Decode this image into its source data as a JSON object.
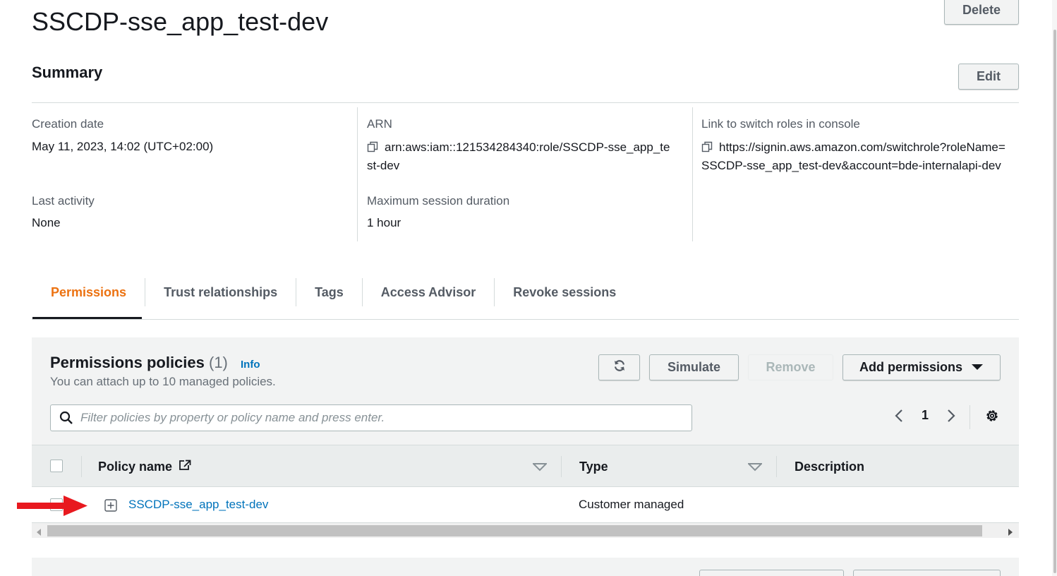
{
  "header": {
    "title": "SSCDP-sse_app_test-dev",
    "delete_label": "Delete"
  },
  "summary": {
    "title": "Summary",
    "edit_label": "Edit",
    "creation_date_label": "Creation date",
    "creation_date_value": "May 11, 2023, 14:02 (UTC+02:00)",
    "last_activity_label": "Last activity",
    "last_activity_value": "None",
    "arn_label": "ARN",
    "arn_value_line1": "arn:aws:iam::121534284340:role/SSCDP-sse_app_te",
    "arn_value_line2": "st-dev",
    "max_session_label": "Maximum session duration",
    "max_session_value": "1 hour",
    "switch_roles_label": "Link to switch roles in console",
    "switch_roles_line1": "https://signin.aws.amazon.com/switchrole?roleName=",
    "switch_roles_line2": "SSCDP-sse_app_test-dev&account=bde-internalapi-dev"
  },
  "tabs": [
    {
      "label": "Permissions",
      "active": true
    },
    {
      "label": "Trust relationships"
    },
    {
      "label": "Tags"
    },
    {
      "label": "Access Advisor"
    },
    {
      "label": "Revoke sessions"
    }
  ],
  "permissions": {
    "title": "Permissions policies",
    "count": "(1)",
    "info_label": "Info",
    "subtitle": "You can attach up to 10 managed policies.",
    "simulate_label": "Simulate",
    "remove_label": "Remove",
    "add_permissions_label": "Add permissions",
    "filter_placeholder": "Filter policies by property or policy name and press enter.",
    "page_number": "1",
    "columns": {
      "policy_name": "Policy name",
      "type": "Type",
      "description": "Description"
    },
    "rows": [
      {
        "policy_name": "SSCDP-sse_app_test-dev",
        "type": "Customer managed",
        "description": ""
      }
    ]
  },
  "colors": {
    "accent": "#ec7211",
    "link": "#0073bb",
    "annotation_arrow": "#e8191f"
  }
}
